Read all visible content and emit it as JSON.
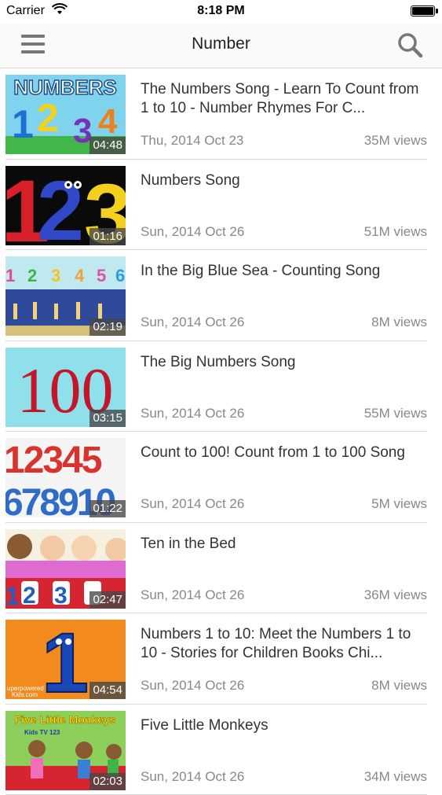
{
  "status_bar": {
    "carrier": "Carrier",
    "time": "8:18 PM"
  },
  "nav": {
    "title": "Number",
    "menu_icon": "hamburger-menu-icon",
    "search_icon": "search-icon"
  },
  "videos": [
    {
      "title": "The Numbers Song - Learn To Count from 1 to 10 - Number Rhymes For C...",
      "date": "Thu, 2014 Oct 23",
      "views": "35M views",
      "duration": "04:48"
    },
    {
      "title": "Numbers Song",
      "date": "Sun, 2014 Oct 26",
      "views": "51M views",
      "duration": "01:16"
    },
    {
      "title": "In the Big Blue Sea - Counting Song",
      "date": "Sun, 2014 Oct 26",
      "views": "8M views",
      "duration": "02:19"
    },
    {
      "title": "The Big Numbers Song",
      "date": "Sun, 2014 Oct 26",
      "views": "55M views",
      "duration": "03:15"
    },
    {
      "title": "Count to 100! Count from 1 to 100 Song",
      "date": "Sun, 2014 Oct 26",
      "views": "5M views",
      "duration": "01:22"
    },
    {
      "title": "Ten in the Bed",
      "date": "Sun, 2014 Oct 26",
      "views": "36M views",
      "duration": "02:47"
    },
    {
      "title": "Numbers 1 to 10: Meet the Numbers 1 to 10 - Stories for Children Books Chi...",
      "date": "Sun, 2014 Oct 26",
      "views": "8M views",
      "duration": "04:54"
    },
    {
      "title": "Five Little Monkeys",
      "date": "Sun, 2014 Oct 26",
      "views": "34M views",
      "duration": "02:03"
    }
  ],
  "thumbnails": {
    "t1": {
      "text": "NUMBERS",
      "digits": [
        "1",
        "2",
        "3",
        "4"
      ]
    },
    "t2": {
      "digits": [
        "1",
        "2",
        "3"
      ]
    },
    "t3": {
      "digits": [
        "1",
        "2",
        "3",
        "4",
        "5",
        "6"
      ]
    },
    "t4": {
      "text": "100"
    },
    "t5": {
      "row1": "12345",
      "row2": "678910"
    },
    "t6": {
      "digits": [
        "1",
        "2",
        "3"
      ]
    },
    "t7": {
      "digit": "1",
      "caption": "uperpowered",
      "caption2": "Kids.com"
    },
    "t8": {
      "text": "Five Little Monkeys",
      "text2": "Kids TV 123"
    }
  }
}
